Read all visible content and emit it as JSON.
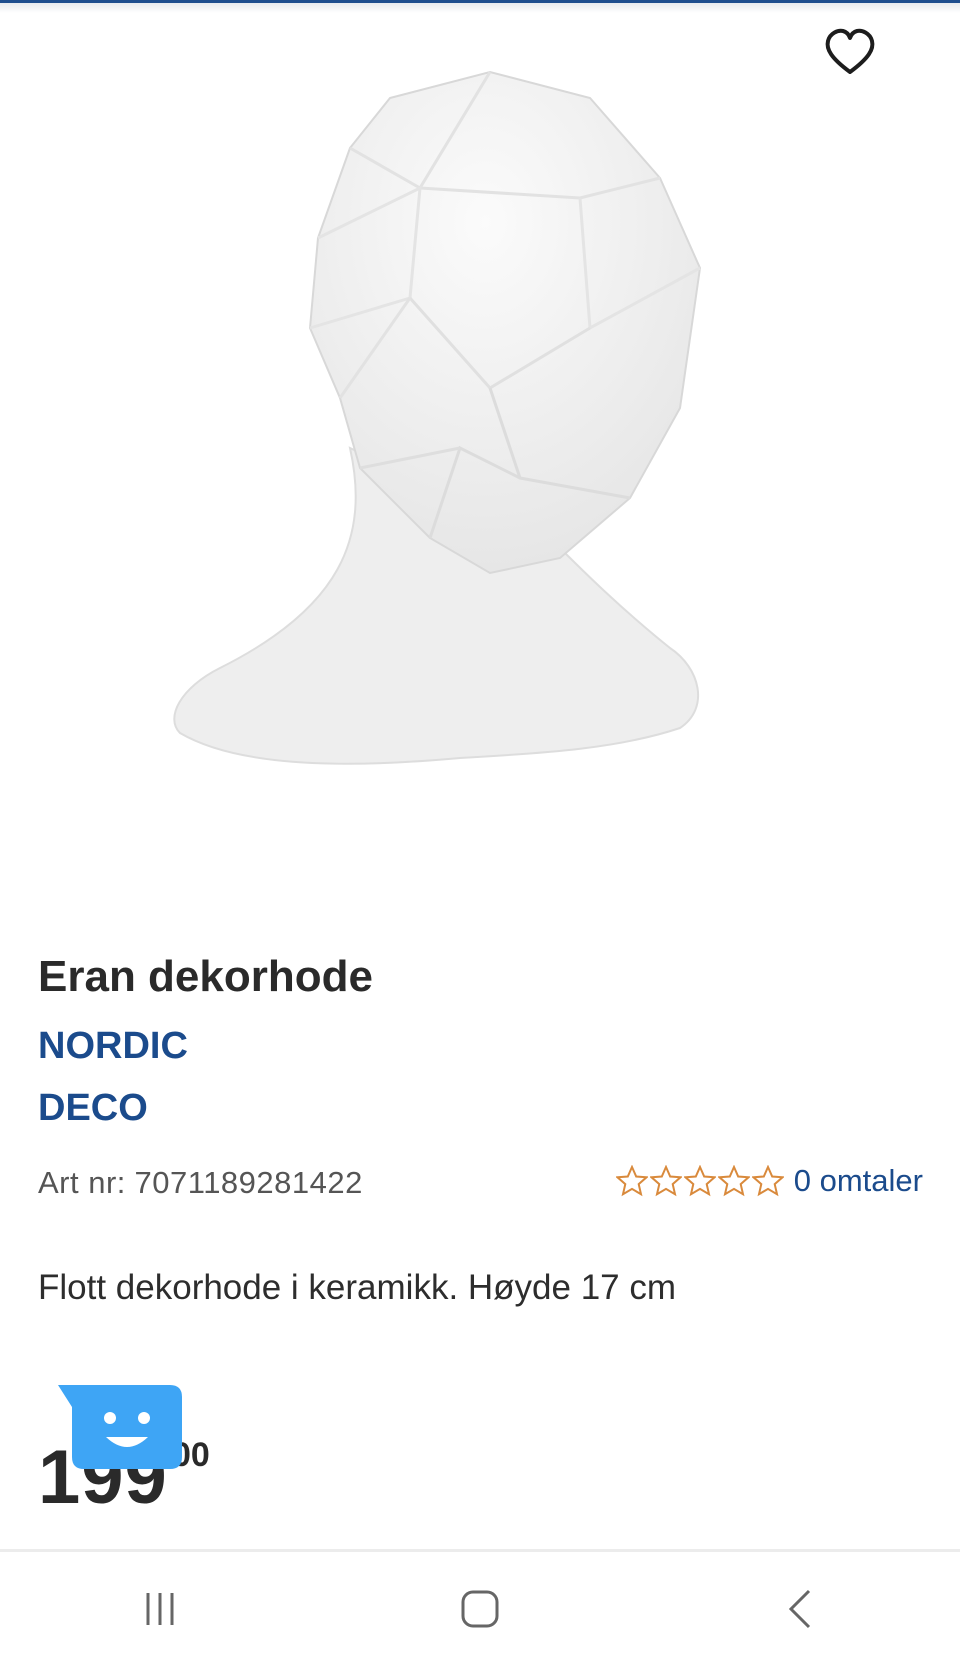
{
  "product": {
    "title": "Eran dekorhode",
    "brand_line1": "NORDIC",
    "brand_line2": "DECO",
    "art_label": "Art nr:",
    "art_number": "7071189281422",
    "rating": {
      "stars": 0,
      "max": 5,
      "reviews_label": "0 omtaler"
    },
    "description": "Flott dekorhode i keramikk. Høyde 17 cm",
    "price": {
      "main": "199",
      "cents": "00"
    }
  },
  "icons": {
    "favorite": "heart-outline-icon",
    "chat": "chat-bot-icon",
    "recents": "recents-icon",
    "home": "home-icon",
    "back": "back-icon"
  },
  "colors": {
    "brand": "#1b4b8c",
    "star": "#d98a3c",
    "chat": "#3ea5f5",
    "top_bar": "#1f4f8f"
  }
}
